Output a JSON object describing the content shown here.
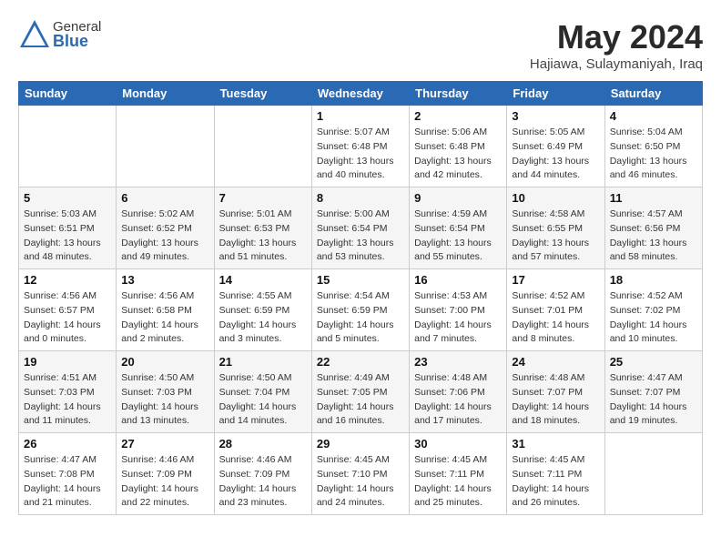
{
  "header": {
    "logo_general": "General",
    "logo_blue": "Blue",
    "month_year": "May 2024",
    "location": "Hajiawa, Sulaymaniyah, Iraq"
  },
  "days_of_week": [
    "Sunday",
    "Monday",
    "Tuesday",
    "Wednesday",
    "Thursday",
    "Friday",
    "Saturday"
  ],
  "weeks": [
    [
      {
        "day": "",
        "info": ""
      },
      {
        "day": "",
        "info": ""
      },
      {
        "day": "",
        "info": ""
      },
      {
        "day": "1",
        "info": "Sunrise: 5:07 AM\nSunset: 6:48 PM\nDaylight: 13 hours\nand 40 minutes."
      },
      {
        "day": "2",
        "info": "Sunrise: 5:06 AM\nSunset: 6:48 PM\nDaylight: 13 hours\nand 42 minutes."
      },
      {
        "day": "3",
        "info": "Sunrise: 5:05 AM\nSunset: 6:49 PM\nDaylight: 13 hours\nand 44 minutes."
      },
      {
        "day": "4",
        "info": "Sunrise: 5:04 AM\nSunset: 6:50 PM\nDaylight: 13 hours\nand 46 minutes."
      }
    ],
    [
      {
        "day": "5",
        "info": "Sunrise: 5:03 AM\nSunset: 6:51 PM\nDaylight: 13 hours\nand 48 minutes."
      },
      {
        "day": "6",
        "info": "Sunrise: 5:02 AM\nSunset: 6:52 PM\nDaylight: 13 hours\nand 49 minutes."
      },
      {
        "day": "7",
        "info": "Sunrise: 5:01 AM\nSunset: 6:53 PM\nDaylight: 13 hours\nand 51 minutes."
      },
      {
        "day": "8",
        "info": "Sunrise: 5:00 AM\nSunset: 6:54 PM\nDaylight: 13 hours\nand 53 minutes."
      },
      {
        "day": "9",
        "info": "Sunrise: 4:59 AM\nSunset: 6:54 PM\nDaylight: 13 hours\nand 55 minutes."
      },
      {
        "day": "10",
        "info": "Sunrise: 4:58 AM\nSunset: 6:55 PM\nDaylight: 13 hours\nand 57 minutes."
      },
      {
        "day": "11",
        "info": "Sunrise: 4:57 AM\nSunset: 6:56 PM\nDaylight: 13 hours\nand 58 minutes."
      }
    ],
    [
      {
        "day": "12",
        "info": "Sunrise: 4:56 AM\nSunset: 6:57 PM\nDaylight: 14 hours\nand 0 minutes."
      },
      {
        "day": "13",
        "info": "Sunrise: 4:56 AM\nSunset: 6:58 PM\nDaylight: 14 hours\nand 2 minutes."
      },
      {
        "day": "14",
        "info": "Sunrise: 4:55 AM\nSunset: 6:59 PM\nDaylight: 14 hours\nand 3 minutes."
      },
      {
        "day": "15",
        "info": "Sunrise: 4:54 AM\nSunset: 6:59 PM\nDaylight: 14 hours\nand 5 minutes."
      },
      {
        "day": "16",
        "info": "Sunrise: 4:53 AM\nSunset: 7:00 PM\nDaylight: 14 hours\nand 7 minutes."
      },
      {
        "day": "17",
        "info": "Sunrise: 4:52 AM\nSunset: 7:01 PM\nDaylight: 14 hours\nand 8 minutes."
      },
      {
        "day": "18",
        "info": "Sunrise: 4:52 AM\nSunset: 7:02 PM\nDaylight: 14 hours\nand 10 minutes."
      }
    ],
    [
      {
        "day": "19",
        "info": "Sunrise: 4:51 AM\nSunset: 7:03 PM\nDaylight: 14 hours\nand 11 minutes."
      },
      {
        "day": "20",
        "info": "Sunrise: 4:50 AM\nSunset: 7:03 PM\nDaylight: 14 hours\nand 13 minutes."
      },
      {
        "day": "21",
        "info": "Sunrise: 4:50 AM\nSunset: 7:04 PM\nDaylight: 14 hours\nand 14 minutes."
      },
      {
        "day": "22",
        "info": "Sunrise: 4:49 AM\nSunset: 7:05 PM\nDaylight: 14 hours\nand 16 minutes."
      },
      {
        "day": "23",
        "info": "Sunrise: 4:48 AM\nSunset: 7:06 PM\nDaylight: 14 hours\nand 17 minutes."
      },
      {
        "day": "24",
        "info": "Sunrise: 4:48 AM\nSunset: 7:07 PM\nDaylight: 14 hours\nand 18 minutes."
      },
      {
        "day": "25",
        "info": "Sunrise: 4:47 AM\nSunset: 7:07 PM\nDaylight: 14 hours\nand 19 minutes."
      }
    ],
    [
      {
        "day": "26",
        "info": "Sunrise: 4:47 AM\nSunset: 7:08 PM\nDaylight: 14 hours\nand 21 minutes."
      },
      {
        "day": "27",
        "info": "Sunrise: 4:46 AM\nSunset: 7:09 PM\nDaylight: 14 hours\nand 22 minutes."
      },
      {
        "day": "28",
        "info": "Sunrise: 4:46 AM\nSunset: 7:09 PM\nDaylight: 14 hours\nand 23 minutes."
      },
      {
        "day": "29",
        "info": "Sunrise: 4:45 AM\nSunset: 7:10 PM\nDaylight: 14 hours\nand 24 minutes."
      },
      {
        "day": "30",
        "info": "Sunrise: 4:45 AM\nSunset: 7:11 PM\nDaylight: 14 hours\nand 25 minutes."
      },
      {
        "day": "31",
        "info": "Sunrise: 4:45 AM\nSunset: 7:11 PM\nDaylight: 14 hours\nand 26 minutes."
      },
      {
        "day": "",
        "info": ""
      }
    ]
  ]
}
